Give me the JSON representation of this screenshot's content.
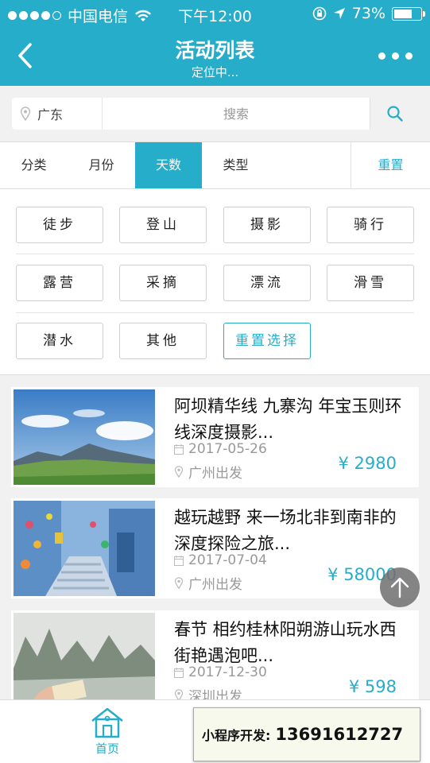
{
  "status_bar": {
    "carrier": "中国电信",
    "time": "下午12:00",
    "battery": "73%",
    "battery_level": 0.73
  },
  "nav": {
    "title": "活动列表",
    "subtitle": "定位中..."
  },
  "search": {
    "city": "广东",
    "placeholder": "搜索"
  },
  "filter_tabs": [
    {
      "label": "分类"
    },
    {
      "label": "月份"
    },
    {
      "label": "天数",
      "active": true
    },
    {
      "label": "类型"
    }
  ],
  "filter_reset": "重置",
  "tags": [
    "徒步",
    "登山",
    "摄影",
    "骑行",
    "露营",
    "采摘",
    "漂流",
    "滑雪",
    "潜水",
    "其他"
  ],
  "tag_reset": "重置选择",
  "activities": [
    {
      "title": "阿坝精华线 九寨沟 年宝玉则环线深度摄影...",
      "date": "2017-05-26",
      "departure": "广州出发",
      "price": "¥ 2980"
    },
    {
      "title": "越玩越野 来一场北非到南非的深度探险之旅...",
      "date": "2017-07-04",
      "departure": "广州出发",
      "price": "¥ 58000"
    },
    {
      "title": "春节 相约桂林阳朔游山玩水西街艳遇泡吧...",
      "date": "2017-12-30",
      "departure": "深圳出发",
      "price": "¥ 598"
    }
  ],
  "tab_bar": {
    "home": "首页"
  },
  "promo": {
    "label": "小程序开发:",
    "phone": "13691612727"
  },
  "colors": {
    "accent": "#26adca"
  }
}
